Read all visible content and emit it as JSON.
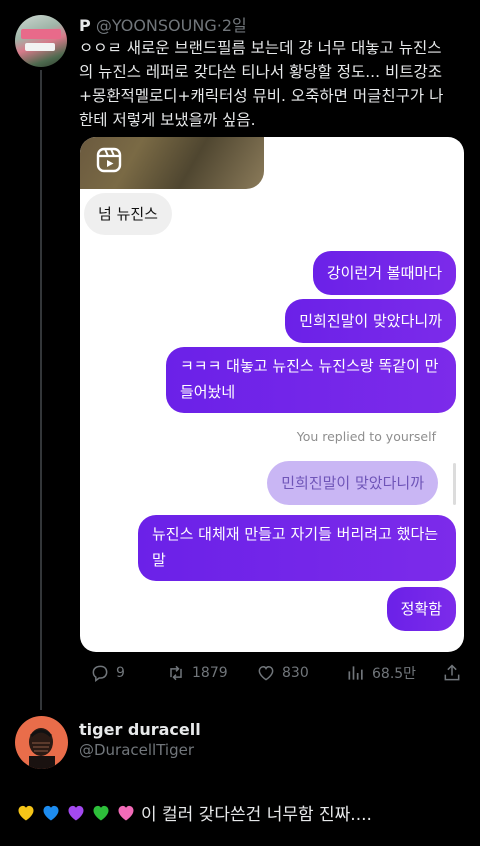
{
  "tweet": {
    "author_name": "P",
    "handle": "@YOONSOUNG",
    "dot": "·",
    "time": "2일",
    "lines": [
      "ㅇㅇㄹ 새로운 브랜드필름 보는데 걍 너무 대놓고 뉴진스",
      "의 뉴진스 레퍼로 갖다쓴 티나서 황당할 정도... 비트강조",
      "+몽환적멜로디+캐릭터성 뮤비. 오죽하면 머글친구가 나",
      "한테 저렇게 보냈을까 싶음."
    ]
  },
  "chat": {
    "incoming": "넘 뉴진스",
    "outgoing_1": "강이런거 볼때마다",
    "outgoing_2": "민희진말이 맞았다니까",
    "outgoing_3": "ㅋㅋㅋ 대놓고 뉴진스 뉴진스랑 똑같이 만들어놨네",
    "replied_label": "You replied to yourself",
    "reply_quote": "민희진말이 맞았다니까",
    "outgoing_4": "뉴진스 대체재 만들고 자기들 버리려고 했다는말",
    "outgoing_5": "정확함"
  },
  "actions": {
    "reply_count": "9",
    "retweet_count": "1879",
    "like_count": "830",
    "view_count": "68.5만"
  },
  "reply": {
    "author_name": "tiger duracell",
    "handle": "@DuracellTiger",
    "text": "이 컬러 갖다쓴건 너무함 진짜....",
    "heart_colors": [
      "#f5c518",
      "#1d8cf0",
      "#a349f0",
      "#2dbf3a",
      "#f26bb8"
    ]
  },
  "colors": {
    "background": "#000000",
    "text": "#e7e9ea",
    "muted": "#71767b",
    "bubble_purple": "#7b1fea"
  }
}
